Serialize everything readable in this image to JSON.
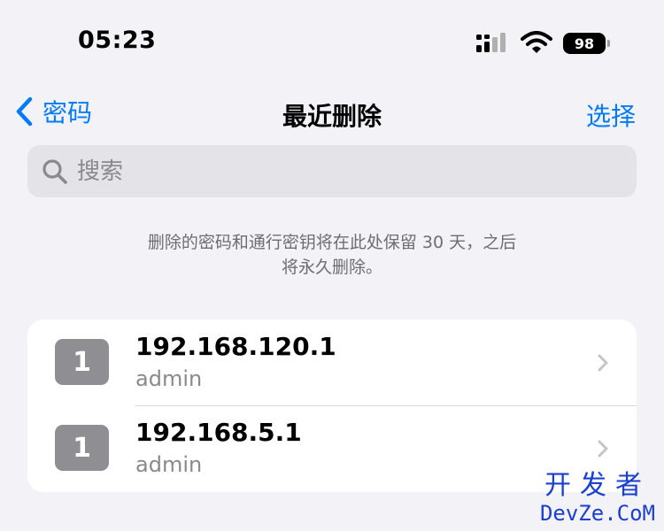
{
  "status_bar": {
    "time": "05:23",
    "battery": "98",
    "signal_icon": "cellular-signal-icon",
    "wifi_icon": "wifi-icon"
  },
  "nav": {
    "back_label": "密码",
    "title": "最近删除",
    "select_label": "选择",
    "accent_color": "#007aff"
  },
  "search": {
    "placeholder": "搜索",
    "value": ""
  },
  "info": {
    "line1": "删除的密码和通行密钥将在此处保留 30 天，之后",
    "line2": "将永久删除。"
  },
  "items": [
    {
      "icon_letter": "1",
      "title": "192.168.120.1",
      "subtitle": "admin"
    },
    {
      "icon_letter": "1",
      "title": "192.168.5.1",
      "subtitle": "admin"
    }
  ],
  "watermark": {
    "top": "开发者",
    "bottom": "DevZe.CoM"
  }
}
